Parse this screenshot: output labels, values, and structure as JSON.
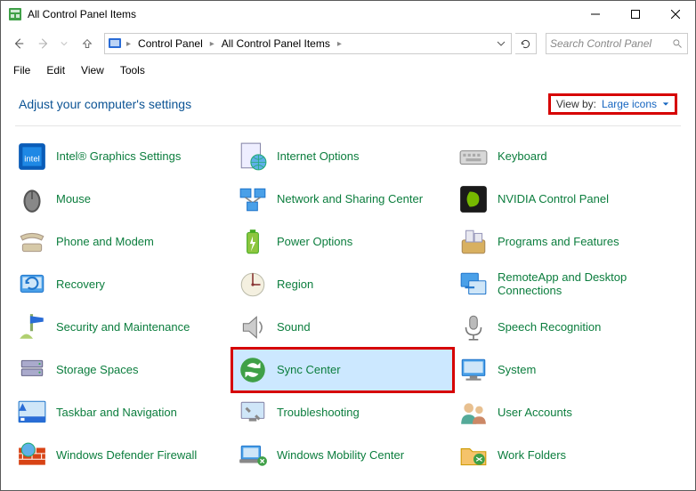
{
  "window": {
    "title": "All Control Panel Items"
  },
  "breadcrumb": {
    "a": "Control Panel",
    "b": "All Control Panel Items"
  },
  "search": {
    "placeholder": "Search Control Panel"
  },
  "menu": {
    "file": "File",
    "edit": "Edit",
    "view": "View",
    "tools": "Tools"
  },
  "header": {
    "title": "Adjust your computer's settings",
    "viewby_label": "View by:",
    "viewby_value": "Large icons"
  },
  "items": [
    {
      "label": "Intel® Graphics Settings"
    },
    {
      "label": "Internet Options"
    },
    {
      "label": "Keyboard"
    },
    {
      "label": "Mouse"
    },
    {
      "label": "Network and Sharing Center"
    },
    {
      "label": "NVIDIA Control Panel"
    },
    {
      "label": "Phone and Modem"
    },
    {
      "label": "Power Options"
    },
    {
      "label": "Programs and Features"
    },
    {
      "label": "Recovery"
    },
    {
      "label": "Region"
    },
    {
      "label": "RemoteApp and Desktop Connections"
    },
    {
      "label": "Security and Maintenance"
    },
    {
      "label": "Sound"
    },
    {
      "label": "Speech Recognition"
    },
    {
      "label": "Storage Spaces"
    },
    {
      "label": "Sync Center"
    },
    {
      "label": "System"
    },
    {
      "label": "Taskbar and Navigation"
    },
    {
      "label": "Troubleshooting"
    },
    {
      "label": "User Accounts"
    },
    {
      "label": "Windows Defender Firewall"
    },
    {
      "label": "Windows Mobility Center"
    },
    {
      "label": "Work Folders"
    }
  ]
}
